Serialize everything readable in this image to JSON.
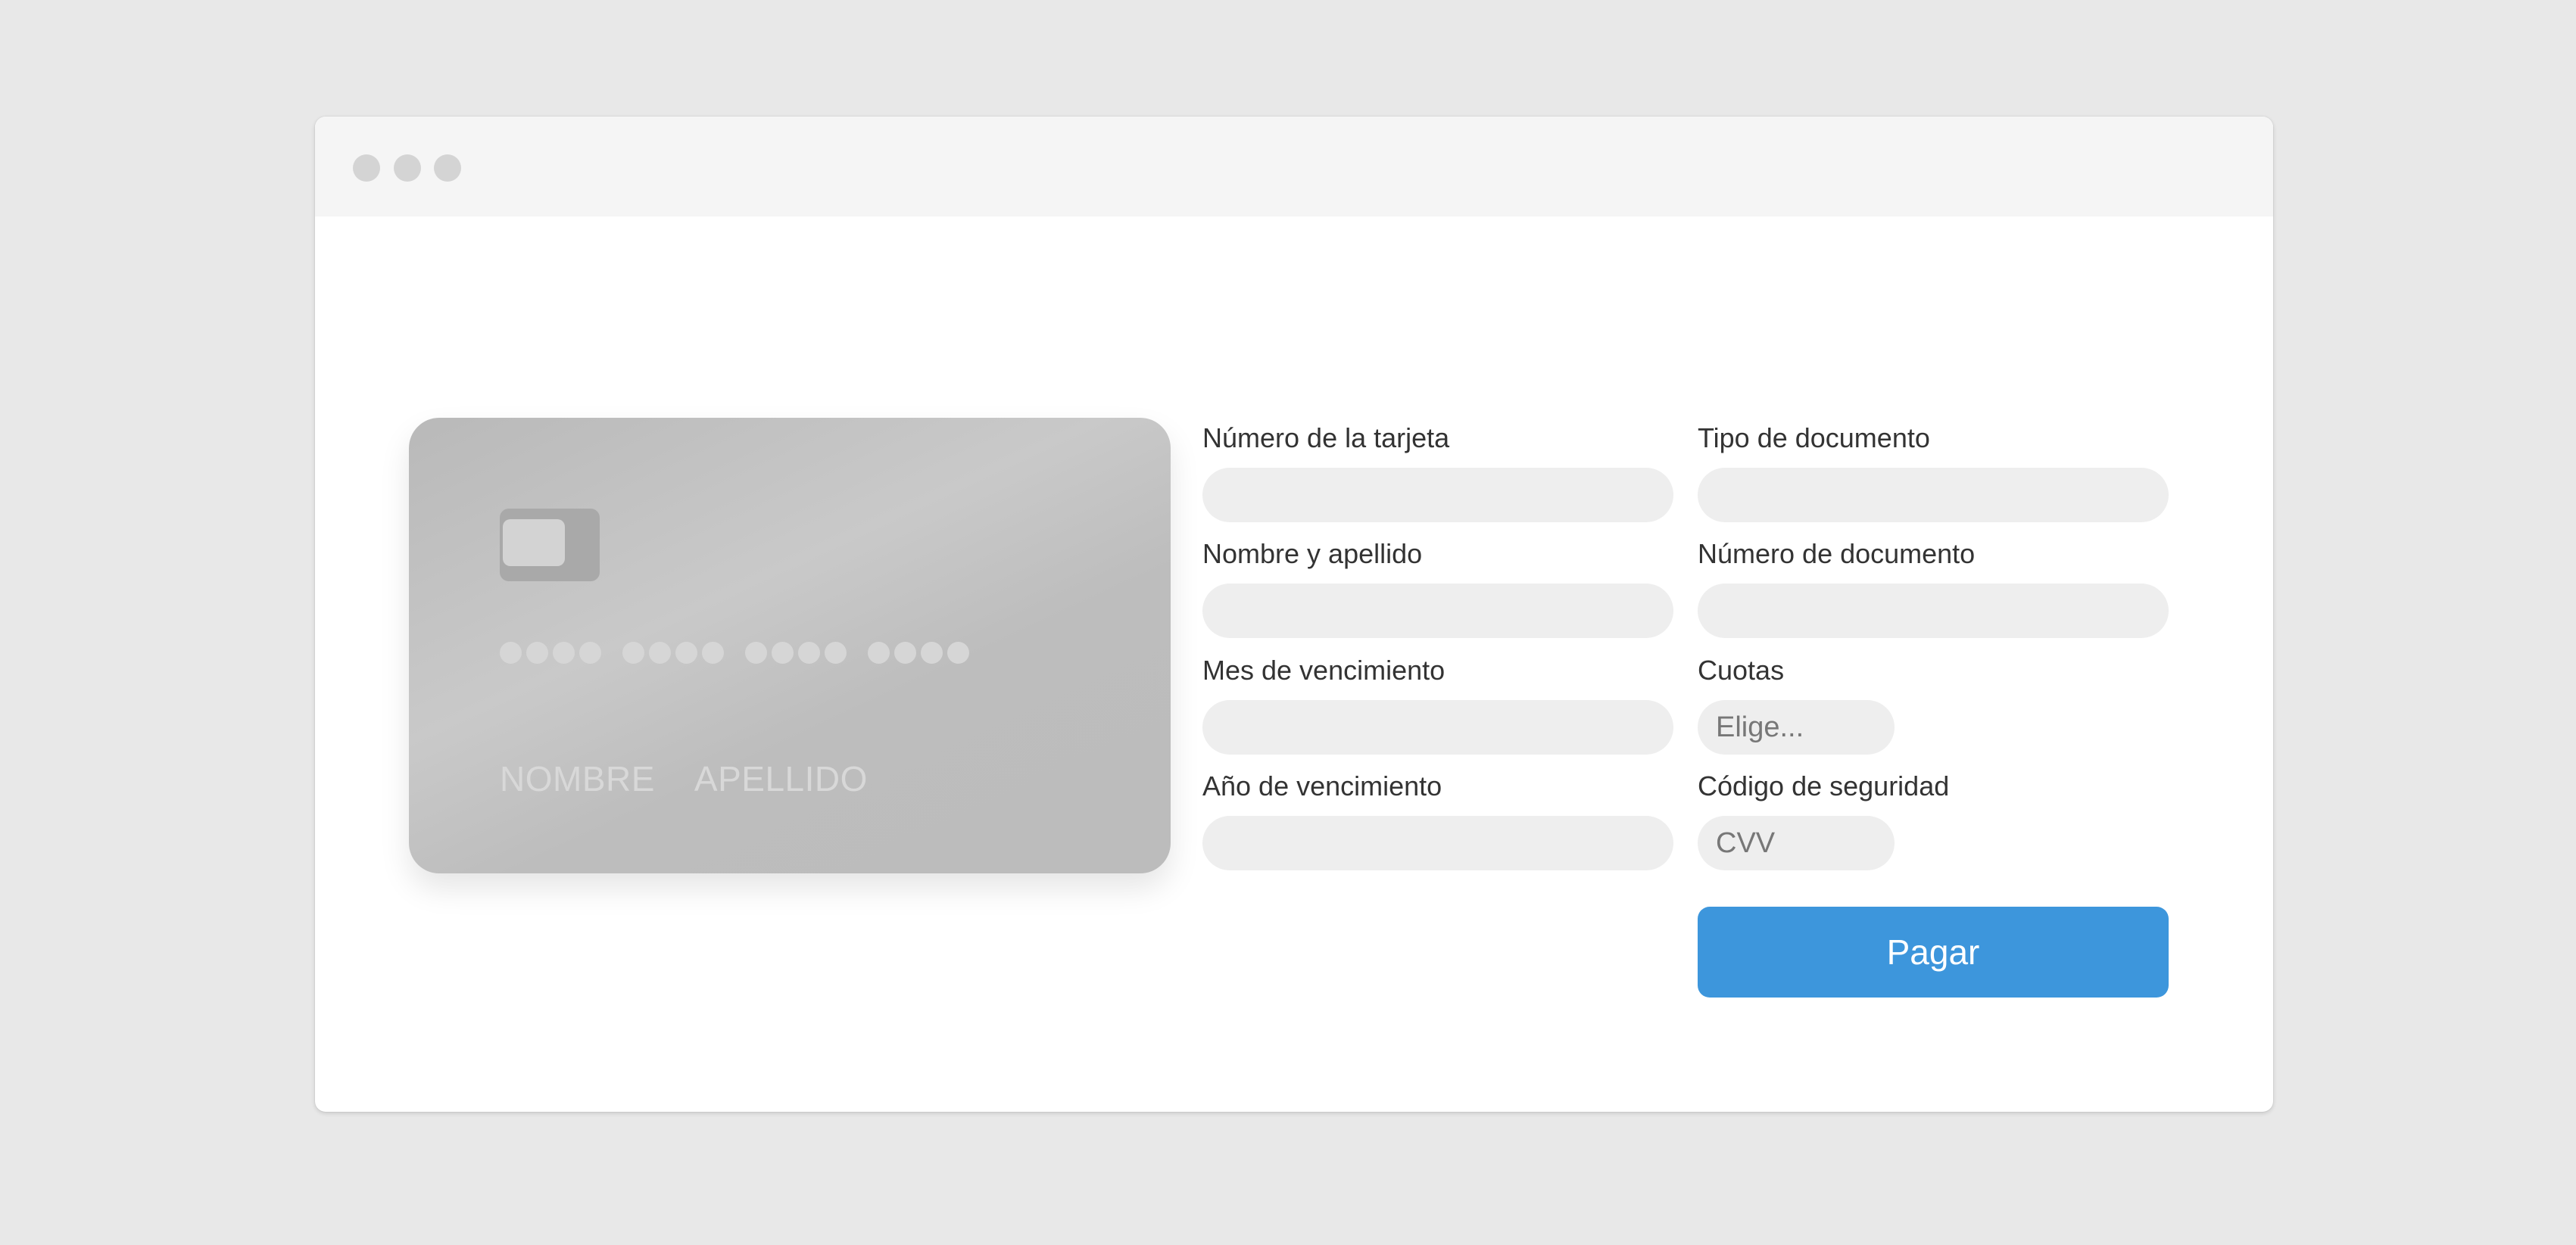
{
  "card": {
    "name_first": "NOMBRE",
    "name_last": "APELLIDO"
  },
  "form": {
    "card_number": {
      "label": "Número de la tarjeta",
      "value": ""
    },
    "document_type": {
      "label": "Tipo de documento",
      "value": ""
    },
    "full_name": {
      "label": "Nombre y apellido",
      "value": ""
    },
    "document_number": {
      "label": "Número de documento",
      "value": ""
    },
    "expiry_month": {
      "label": "Mes de vencimiento",
      "value": ""
    },
    "installments": {
      "label": "Cuotas",
      "placeholder": "Elige..."
    },
    "expiry_year": {
      "label": "Año de vencimiento",
      "value": ""
    },
    "security_code": {
      "label": "Código de seguridad",
      "placeholder": "CVV"
    },
    "pay_button_label": "Pagar"
  },
  "colors": {
    "accent": "#3d96dc",
    "card": "#c0c0c0",
    "field_background": "#eeeeee"
  }
}
